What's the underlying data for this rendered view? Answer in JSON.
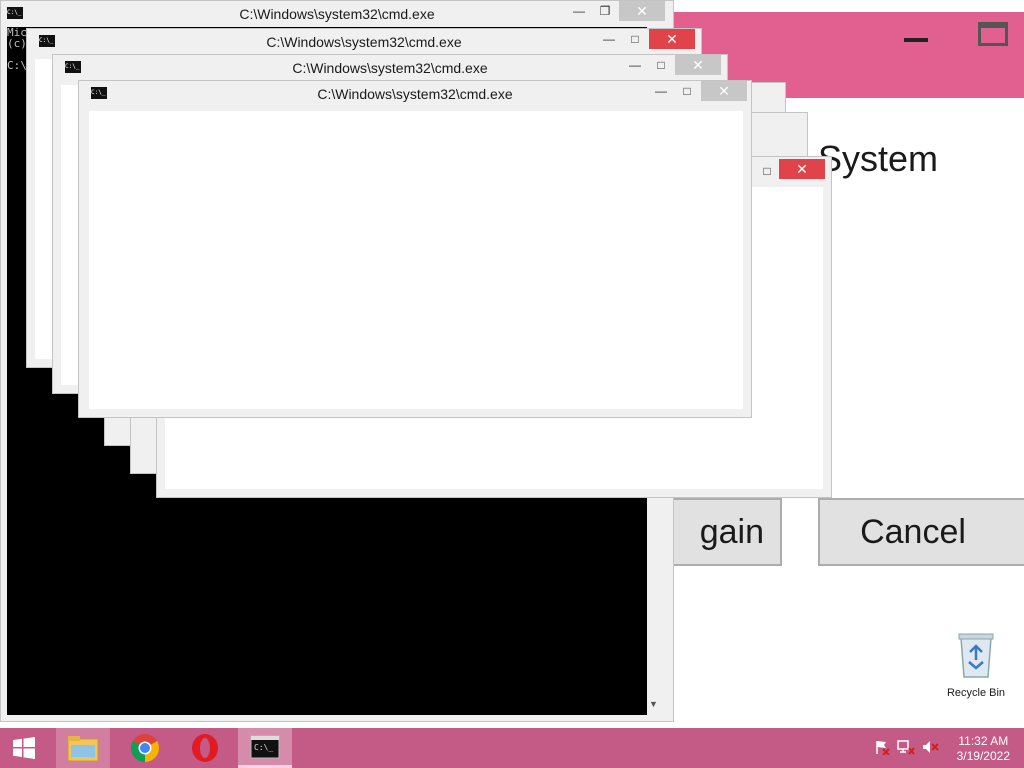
{
  "background_dialog": {
    "title_fragment": "System",
    "retry_label_fragment": "gain",
    "cancel_label": "Cancel",
    "titlebar_color": "#e26090"
  },
  "desktop": {
    "recycle_bin_label": "Recycle Bin"
  },
  "cmd_windows": [
    {
      "title": "C:\\Windows\\system32\\cmd.exe",
      "icon_text": "C:\\_"
    },
    {
      "title": "C:\\Windows\\system32\\cmd.exe",
      "icon_text": "C:\\_"
    },
    {
      "title": "C:\\Windows\\system32\\cmd.exe",
      "icon_text": "C:\\_"
    },
    {
      "title": "C:\\Windows\\system32\\cmd.exe",
      "icon_text": "C:\\_"
    }
  ],
  "console": {
    "lines": [
      "Mic",
      "(c)",
      "",
      "C:\\"
    ]
  },
  "taskbar": {
    "time": "11:32 AM",
    "date": "3/19/2022",
    "apps": [
      "windows-start",
      "file-explorer",
      "chrome",
      "opera",
      "command-prompt"
    ],
    "color": "#c45a86"
  }
}
